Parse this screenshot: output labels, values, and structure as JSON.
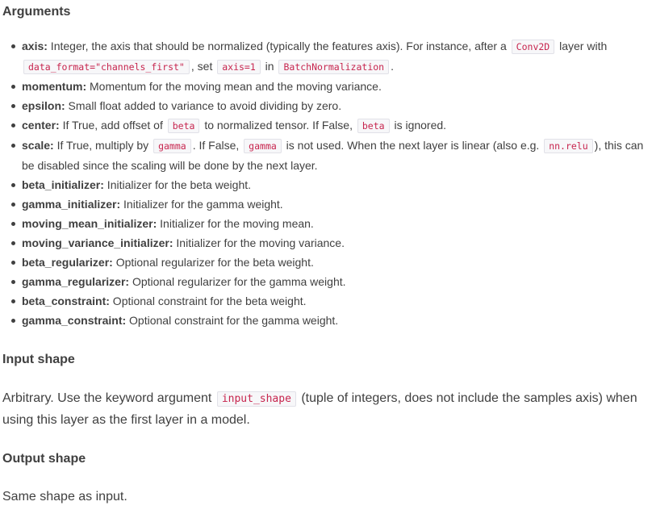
{
  "sections": {
    "arguments_heading": "Arguments",
    "input_heading": "Input shape",
    "output_heading": "Output shape"
  },
  "args": {
    "axis": {
      "term": "axis:",
      "t1": " Integer, the axis that should be normalized (typically the features axis). For instance, after a ",
      "c1": "Conv2D",
      "t2": " layer with ",
      "c2": "data_format=\"channels_first\"",
      "t3": ", set ",
      "c3": "axis=1",
      "t4": " in ",
      "c4": "BatchNormalization",
      "t5": "."
    },
    "momentum": {
      "term": "momentum:",
      "desc": " Momentum for the moving mean and the moving variance."
    },
    "epsilon": {
      "term": "epsilon:",
      "desc": " Small float added to variance to avoid dividing by zero."
    },
    "center": {
      "term": "center:",
      "t1": " If True, add offset of ",
      "c1": "beta",
      "t2": " to normalized tensor. If False, ",
      "c2": "beta",
      "t3": " is ignored."
    },
    "scale": {
      "term": "scale:",
      "t1": " If True, multiply by ",
      "c1": "gamma",
      "t2": ". If False, ",
      "c2": "gamma",
      "t3": " is not used. When the next layer is linear (also e.g. ",
      "c3": "nn.relu",
      "t4": "), this can be disabled since the scaling will be done by the next layer."
    },
    "beta_initializer": {
      "term": "beta_initializer:",
      "desc": " Initializer for the beta weight."
    },
    "gamma_initializer": {
      "term": "gamma_initializer:",
      "desc": " Initializer for the gamma weight."
    },
    "moving_mean_initializer": {
      "term": "moving_mean_initializer:",
      "desc": " Initializer for the moving mean."
    },
    "moving_variance_initializer": {
      "term": "moving_variance_initializer:",
      "desc": " Initializer for the moving variance."
    },
    "beta_regularizer": {
      "term": "beta_regularizer:",
      "desc": " Optional regularizer for the beta weight."
    },
    "gamma_regularizer": {
      "term": "gamma_regularizer:",
      "desc": " Optional regularizer for the gamma weight."
    },
    "beta_constraint": {
      "term": "beta_constraint:",
      "desc": " Optional constraint for the beta weight."
    },
    "gamma_constraint": {
      "term": "gamma_constraint:",
      "desc": " Optional constraint for the gamma weight."
    }
  },
  "input_shape": {
    "t1": "Arbitrary. Use the keyword argument ",
    "c1": "input_shape",
    "t2": " (tuple of integers, does not include the samples axis) when using this layer as the first layer in a model."
  },
  "output_shape": {
    "text": "Same shape as input."
  },
  "colors": {
    "text": "#404040",
    "code_text": "#c7254e",
    "code_bg": "#f7f7f9",
    "code_border": "#e1e1e8"
  }
}
